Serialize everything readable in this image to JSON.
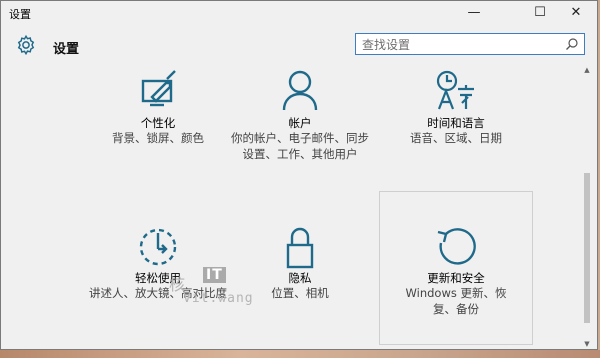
{
  "window": {
    "title": "设置"
  },
  "controls": {
    "minimize": "—",
    "maximize": "☐",
    "close": "✕"
  },
  "header": {
    "title": "设置"
  },
  "search": {
    "placeholder": "查找设置"
  },
  "tiles": [
    {
      "label": "个性化",
      "desc": "背景、锁屏、颜色",
      "icon": "personalization-icon"
    },
    {
      "label": "帐户",
      "desc": "你的帐户、电子邮件、同步设置、工作、其他用户",
      "icon": "account-icon"
    },
    {
      "label": "时间和语言",
      "desc": "语音、区域、日期",
      "icon": "time-language-icon"
    },
    {
      "label": "轻松使用",
      "desc": "讲述人、放大镜、高对比度",
      "icon": "ease-of-access-icon"
    },
    {
      "label": "隐私",
      "desc": "位置、相机",
      "icon": "lock-icon"
    },
    {
      "label": "更新和安全",
      "desc": "Windows 更新、恢复、备份",
      "icon": "update-icon"
    }
  ],
  "watermark": {
    "brand": "IT",
    "char": "核",
    "site": "Vit.wang"
  },
  "colors": {
    "accent": "#1f6a8a",
    "selected_border": "#cfcfcf",
    "search_border": "#3d7dc2"
  }
}
